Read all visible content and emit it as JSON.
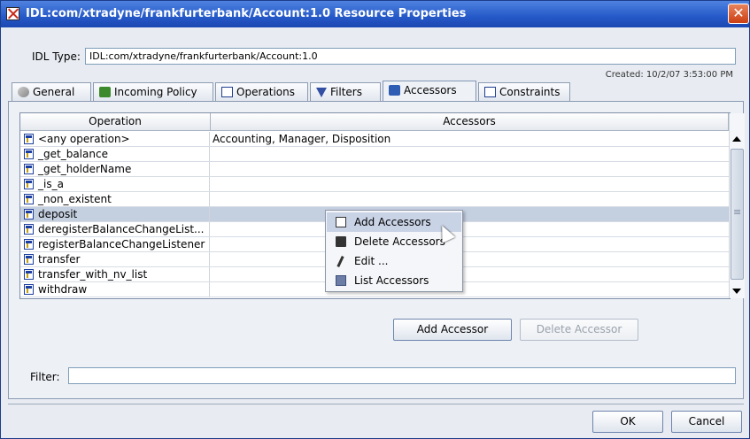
{
  "window": {
    "title": "IDL:com/xtradyne/frankfurterbank/Account:1.0 Resource Properties",
    "close_label": "✕"
  },
  "idl_type": {
    "label": "IDL Type:",
    "value": "IDL:com/xtradyne/frankfurterbank/Account:1.0"
  },
  "created": "Created: 10/2/07 3:53:00 PM",
  "tabs": [
    {
      "label": "General",
      "icon": "general-icon"
    },
    {
      "label": "Incoming Policy",
      "icon": "policy-icon"
    },
    {
      "label": "Operations",
      "icon": "operations-icon"
    },
    {
      "label": "Filters",
      "icon": "filter-icon"
    },
    {
      "label": "Accessors",
      "icon": "accessors-icon",
      "active": true
    },
    {
      "label": "Constraints",
      "icon": "constraints-icon"
    }
  ],
  "table": {
    "headers": {
      "operation": "Operation",
      "accessors": "Accessors"
    },
    "rows": [
      {
        "operation": "<any operation>",
        "accessors": "Accounting, Manager, Disposition"
      },
      {
        "operation": "_get_balance",
        "accessors": ""
      },
      {
        "operation": "_get_holderName",
        "accessors": ""
      },
      {
        "operation": "_is_a",
        "accessors": ""
      },
      {
        "operation": "_non_existent",
        "accessors": ""
      },
      {
        "operation": "deposit",
        "accessors": "",
        "selected": true
      },
      {
        "operation": "deregisterBalanceChangeList...",
        "accessors": ""
      },
      {
        "operation": "registerBalanceChangeListener",
        "accessors": ""
      },
      {
        "operation": "transfer",
        "accessors": ""
      },
      {
        "operation": "transfer_with_nv_list",
        "accessors": ""
      },
      {
        "operation": "withdraw",
        "accessors": ""
      }
    ]
  },
  "context_menu": {
    "items": [
      {
        "label": "Add Accessors",
        "icon": "add-icon",
        "hover": true
      },
      {
        "label": "Delete Accessors",
        "icon": "trash-icon"
      },
      {
        "label": "Edit ...",
        "icon": "pencil-icon"
      },
      {
        "label": "List Accessors",
        "icon": "list-icon"
      }
    ]
  },
  "buttons": {
    "add_accessor": "Add Accessor",
    "delete_accessor": "Delete Accessor",
    "ok": "OK",
    "cancel": "Cancel"
  },
  "filter": {
    "label": "Filter:",
    "value": ""
  }
}
